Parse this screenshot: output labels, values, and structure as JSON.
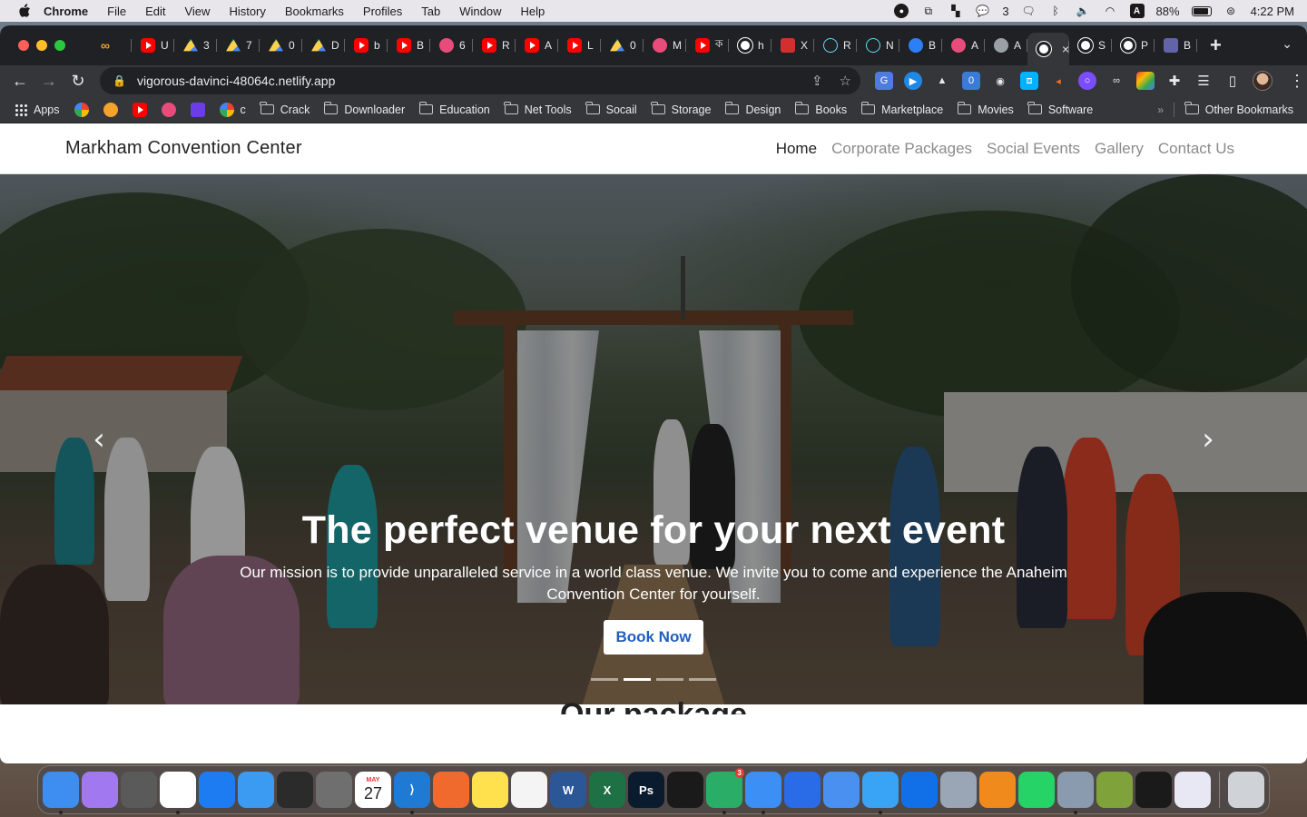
{
  "menubar": {
    "app_name": "Chrome",
    "items": [
      "File",
      "Edit",
      "View",
      "History",
      "Bookmarks",
      "Profiles",
      "Tab",
      "Window",
      "Help"
    ],
    "wechat_count": "3",
    "input_source": "A",
    "battery": "88%",
    "clock": "4:22 PM"
  },
  "tabs": [
    {
      "icon": "infinity-icon",
      "label": ""
    },
    {
      "icon": "youtube-icon",
      "label": "U"
    },
    {
      "icon": "drive-icon",
      "label": "3"
    },
    {
      "icon": "drive-icon",
      "label": "7"
    },
    {
      "icon": "drive-icon",
      "label": "0"
    },
    {
      "icon": "drive-icon",
      "label": "D"
    },
    {
      "icon": "youtube-icon",
      "label": "b"
    },
    {
      "icon": "youtube-icon",
      "label": "B"
    },
    {
      "icon": "target-icon",
      "label": "6"
    },
    {
      "icon": "youtube-icon",
      "label": "R"
    },
    {
      "icon": "youtube-icon",
      "label": "A"
    },
    {
      "icon": "youtube-icon",
      "label": "L"
    },
    {
      "icon": "drive-icon",
      "label": "0"
    },
    {
      "icon": "figma-icon",
      "label": "M"
    },
    {
      "icon": "youtube-icon",
      "label": "ক"
    },
    {
      "icon": "globe-icon",
      "label": "h"
    },
    {
      "icon": "pdf-icon",
      "label": "X"
    },
    {
      "icon": "react-icon",
      "label": "R"
    },
    {
      "icon": "react-icon",
      "label": "N"
    },
    {
      "icon": "c-icon",
      "label": "B"
    },
    {
      "icon": "figma-icon",
      "label": "A"
    },
    {
      "icon": "web-icon",
      "label": "A"
    },
    {
      "icon": "globe-icon",
      "label": "",
      "active": true
    },
    {
      "icon": "globe-icon",
      "label": "S"
    },
    {
      "icon": "globe-icon",
      "label": "P"
    },
    {
      "icon": "teams-icon",
      "label": "B"
    }
  ],
  "address_bar": {
    "url": "vigorous-davinci-48064c.netlify.app"
  },
  "bookmarks": {
    "apps_label": "Apps",
    "c_label": "c",
    "folders": [
      "Crack",
      "Downloader",
      "Education",
      "Net Tools",
      "Socail",
      "Storage",
      "Design",
      "Books",
      "Marketplace",
      "Movies",
      "Software"
    ],
    "more": "»",
    "other": "Other Bookmarks"
  },
  "site": {
    "brand": "Markham Convention Center",
    "nav": [
      "Home",
      "Corporate Packages",
      "Social Events",
      "Gallery",
      "Contact Us"
    ],
    "active_nav": "Home",
    "hero": {
      "title": "The perfect venue for your next event",
      "subtitle": "Our mission is to provide unparalleled service in a world class venue. We invite you to come and experience the Anaheim Convention Center for yourself.",
      "button": "Book Now",
      "slides": 4,
      "active_slide": 2
    },
    "section_title": "Our package"
  },
  "dock": {
    "apps": [
      "Finder",
      "Quill",
      "Calculator",
      "Chrome",
      "Safari",
      "Mail",
      "Photo Booth",
      "Screenshot",
      "Calendar",
      "VS Code",
      "Pages",
      "Notes",
      "TextEdit",
      "Word",
      "Excel",
      "Photoshop",
      "Activity Monitor",
      "WeChat",
      "Direct Mail",
      "Messenger",
      "Extension",
      "Remote",
      "TeamViewer",
      "System Preferences",
      "VLC",
      "WhatsApp",
      "Preview",
      "Cyberduck",
      "Terminal",
      "Box",
      "Trash"
    ],
    "calendar_month": "MAY",
    "calendar_day": "27",
    "wechat_badge": "3"
  },
  "colors": {
    "link_blue": "#1f5fbf",
    "tab_bg": "#202124",
    "toolbar_bg": "#35363a"
  }
}
